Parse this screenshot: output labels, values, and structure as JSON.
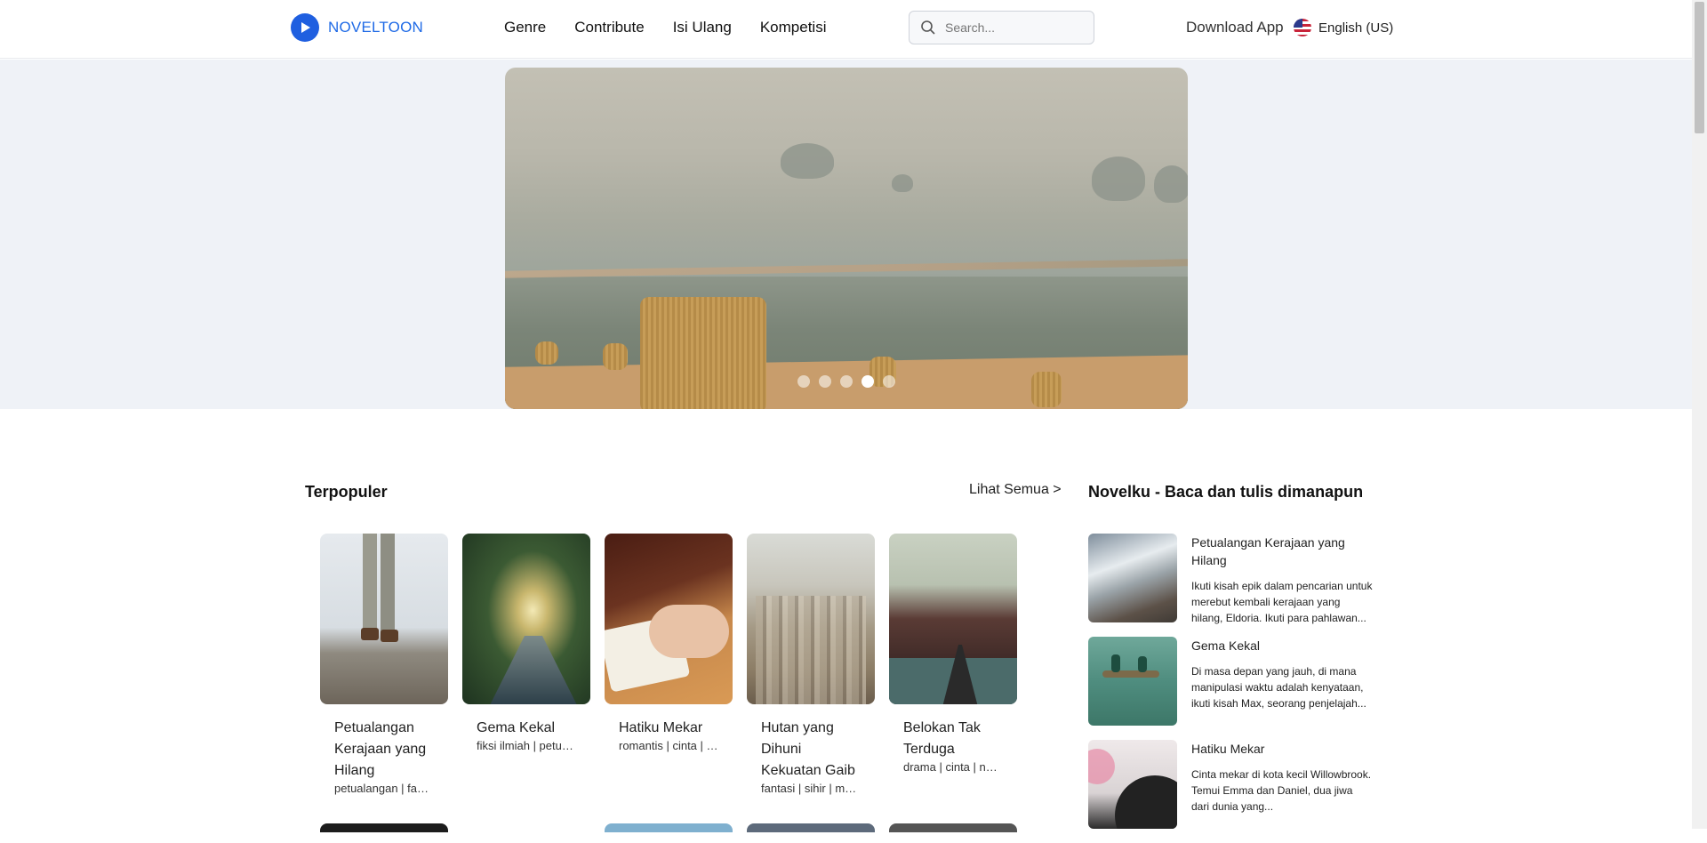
{
  "header": {
    "logo_text": "NOVELTOON",
    "nav": [
      "Genre",
      "Contribute",
      "Isi Ulang",
      "Kompetisi"
    ],
    "search_placeholder": "Search...",
    "download": "Download App",
    "language": "English (US)"
  },
  "banner": {
    "slides_count": 5,
    "active_index": 3
  },
  "popular": {
    "title": "Terpopuler",
    "see_all": "Lihat Semua >",
    "items": [
      {
        "title": "Petualangan Kerajaan yang Hilang",
        "tags": "petualangan | fantasi"
      },
      {
        "title": "Gema Kekal",
        "tags": "fiksi ilmiah | petualangan"
      },
      {
        "title": "Hatiku Mekar",
        "tags": "romantis | cinta | kota"
      },
      {
        "title": "Hutan yang Dihuni Kekuatan Gaib",
        "tags": "fantasi | sihir | makhluk"
      },
      {
        "title": "Belokan Tak Terduga",
        "tags": "drama | cinta | nasib"
      }
    ]
  },
  "side": {
    "title": "Novelku - Baca dan tulis dimanapun",
    "items": [
      {
        "title": "Petualangan Kerajaan yang Hilang",
        "desc": "Ikuti kisah epik dalam pencarian untuk merebut kembali kerajaan yang hilang, Eldoria. Ikuti para pahlawan..."
      },
      {
        "title": "Gema Kekal",
        "desc": "Di masa depan yang jauh, di mana manipulasi waktu adalah kenyataan, ikuti kisah Max, seorang penjelajah..."
      },
      {
        "title": "Hatiku Mekar",
        "desc": "Cinta mekar di kota kecil Willowbrook. Temui Emma dan Daniel, dua jiwa dari dunia yang..."
      }
    ]
  }
}
